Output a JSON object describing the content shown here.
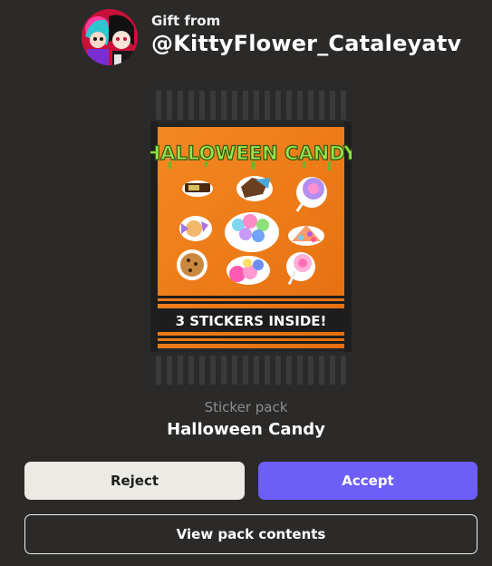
{
  "gift": {
    "from_label": "Gift from",
    "username": "@KittyFlower_Cataleyatv"
  },
  "pack": {
    "art_title": "HALLOWEEN CANDY",
    "art_banner": "3 STICKERS INSIDE!",
    "type_label": "Sticker pack",
    "name": "Halloween Candy"
  },
  "actions": {
    "reject_label": "Reject",
    "accept_label": "Accept",
    "view_label": "View pack contents"
  },
  "colors": {
    "background": "#2b2a29",
    "accent": "#6c5ef7",
    "reject_bg": "#eceae5",
    "pack_orange": "#f07a14"
  },
  "icons": [
    "avatar-image",
    "candy-bar-icon",
    "chocolate-icon",
    "lollipop-icon",
    "wrapped-candy-icon",
    "balloon-candy-icon",
    "candy-pile-icon",
    "cookie-icon",
    "gumball-icon",
    "swirl-lollipop-icon"
  ]
}
